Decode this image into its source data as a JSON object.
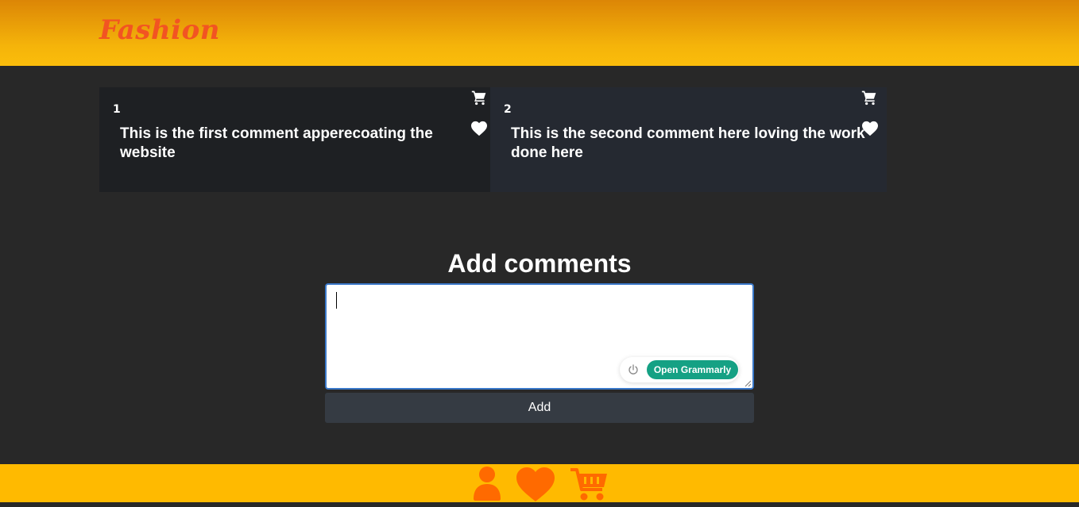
{
  "header": {
    "brand": "Fashion"
  },
  "comments": [
    {
      "number": "1",
      "text": "This is the first comment apperecoating the website",
      "cart_icon": "cart-icon",
      "heart_icon": "heart-icon"
    },
    {
      "number": "2",
      "text": "This is the second comment here loving the work done here",
      "cart_icon": "cart-icon",
      "heart_icon": "heart-icon"
    }
  ],
  "add_section": {
    "title": "Add comments",
    "textarea_value": "",
    "button_label": "Add"
  },
  "grammarly": {
    "button_label": "Open Grammarly",
    "power_icon": "power-icon"
  },
  "footer": {
    "icons": [
      "user-icon",
      "heart-icon",
      "cart-icon"
    ]
  },
  "colors": {
    "header_top": "#dc8606",
    "header_bottom": "#fbbd0b",
    "brand": "#f25422",
    "background": "#282828",
    "footer": "#ffba00",
    "footer_icons": "#ff6a00",
    "grammarly": "#15a184"
  }
}
